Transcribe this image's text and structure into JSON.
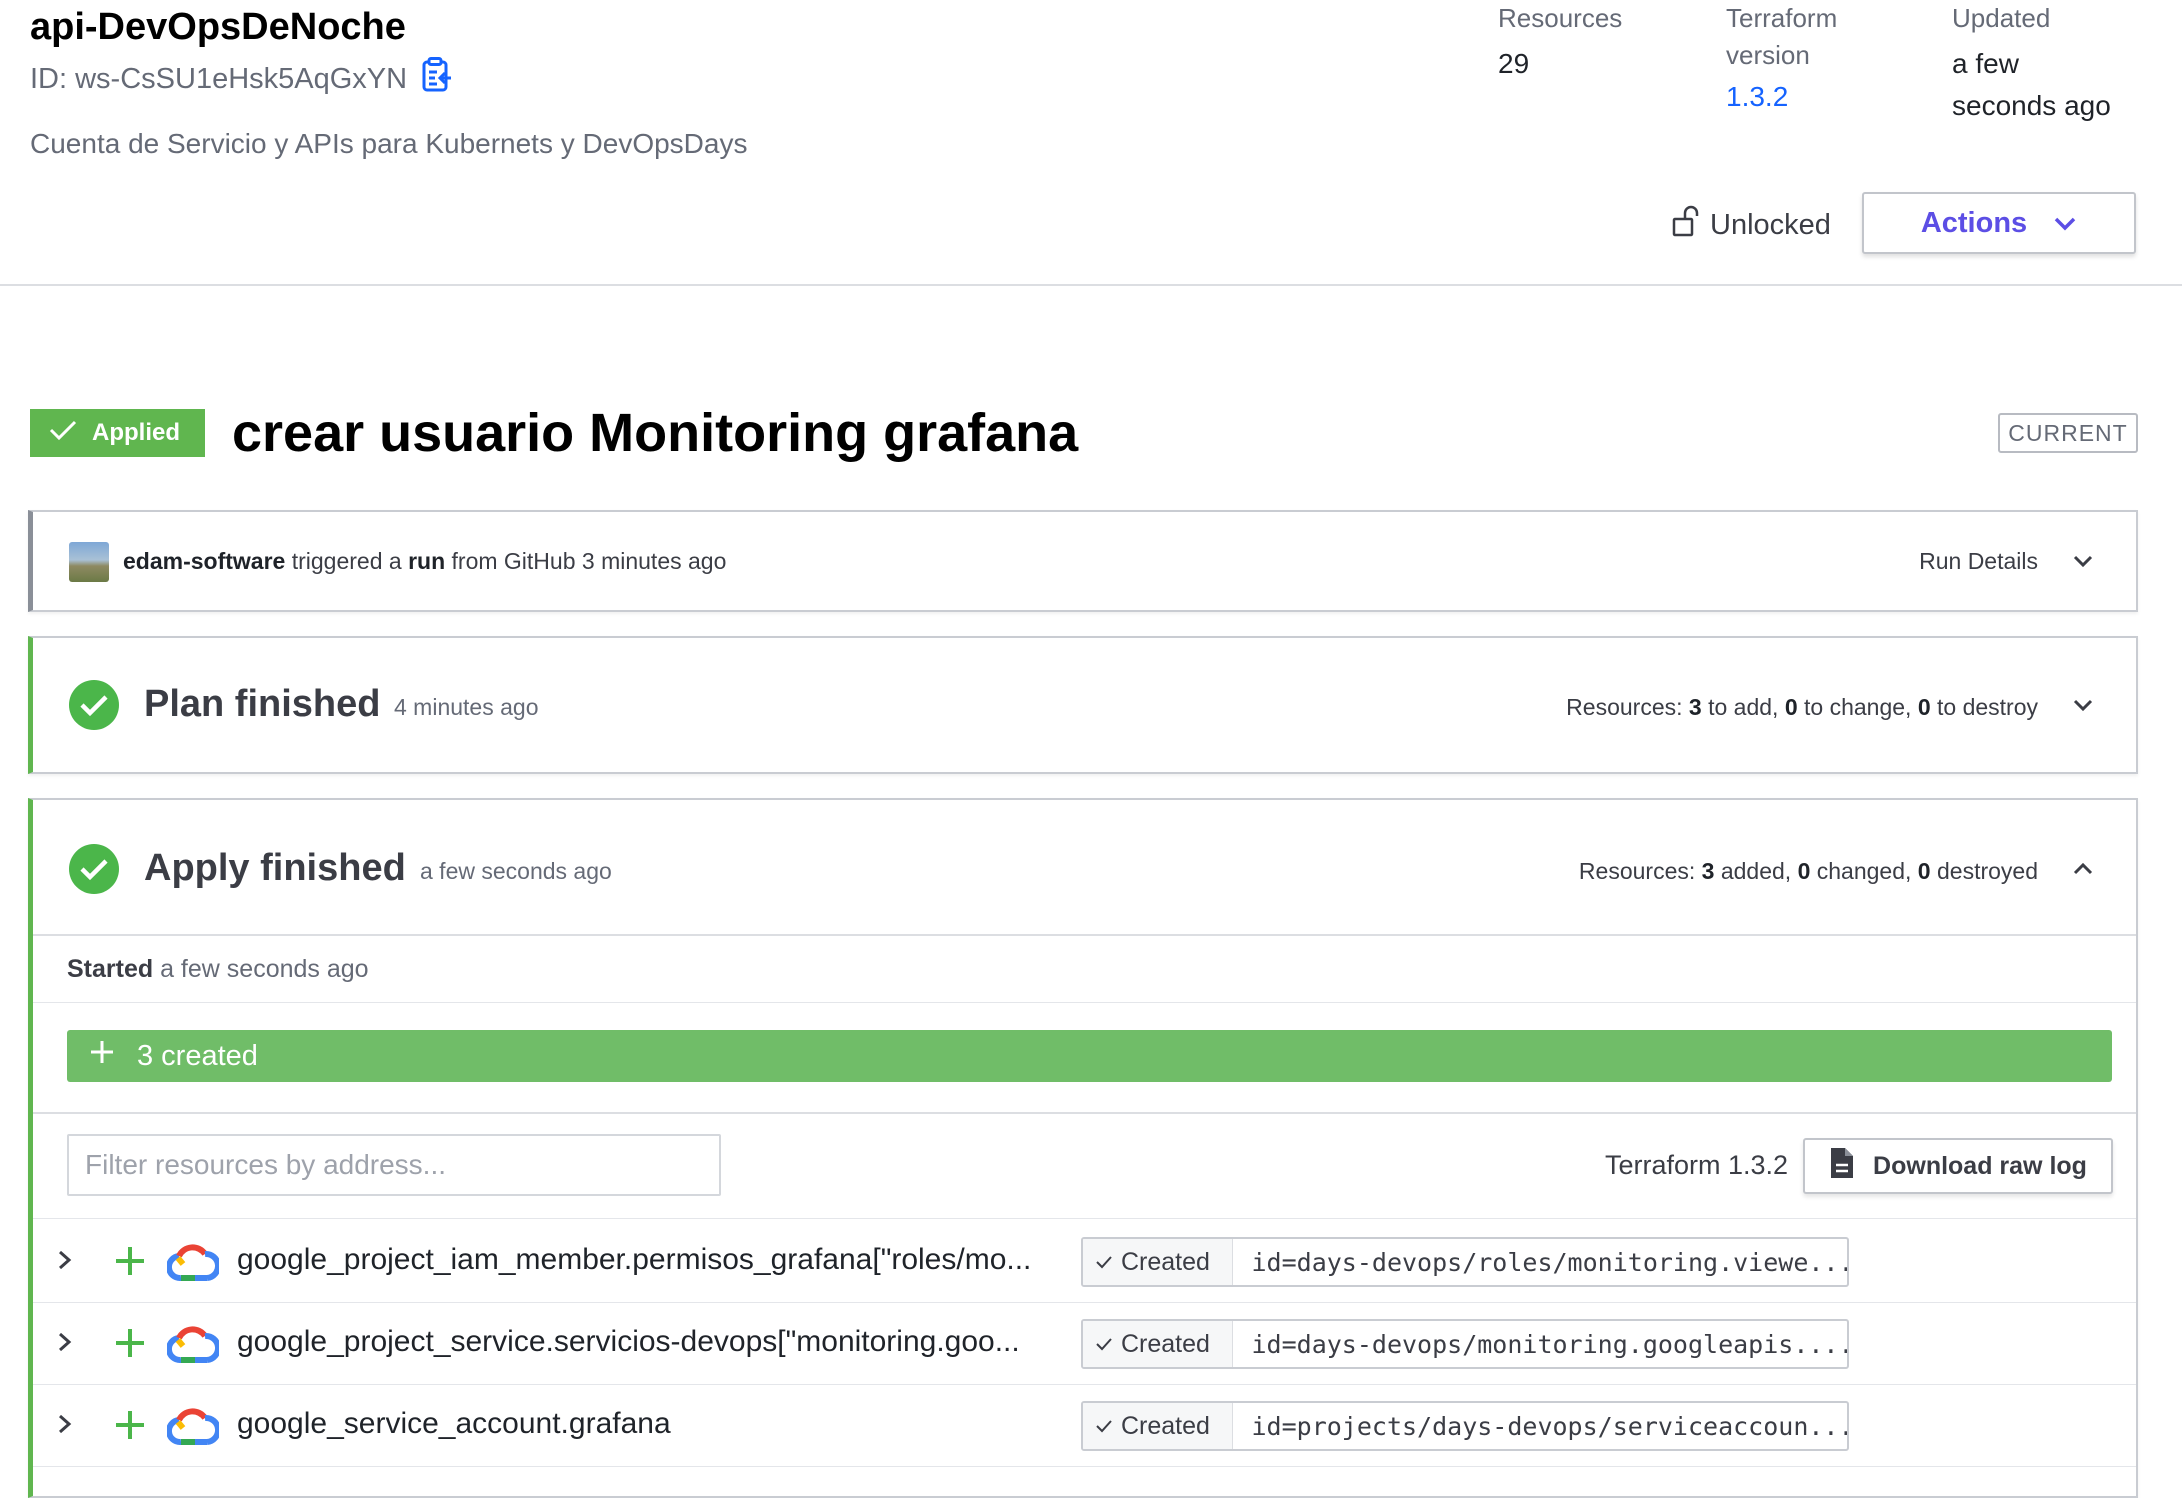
{
  "workspace": {
    "name": "api-DevOpsDeNoche",
    "id": "ID: ws-CsSU1eHsk5AqGxYN",
    "description": "Cuenta de Servicio y APIs para Kubernets y DevOpsDays",
    "meta": {
      "resources_label": "Resources",
      "resources_value": "29",
      "tf_version_label_1": "Terraform",
      "tf_version_label_2": "version",
      "tf_version_value": "1.3.2",
      "updated_label": "Updated",
      "updated_value_1": "a few",
      "updated_value_2": "seconds ago"
    },
    "lock_status": "Unlocked",
    "actions_label": "Actions"
  },
  "run": {
    "status_badge": "Applied",
    "title": "crear usuario Monitoring grafana",
    "current_badge": "CURRENT",
    "trigger": {
      "user": "edam-software",
      "text_1": " triggered a ",
      "run_word": "run",
      "text_2": " from GitHub 3 minutes ago",
      "details_label": "Run Details"
    },
    "plan": {
      "title": "Plan finished",
      "time": "4 minutes ago",
      "res_prefix": "Resources: ",
      "add": "3",
      "add_label": " to add, ",
      "change": "0",
      "change_label": " to change, ",
      "destroy": "0",
      "destroy_label": " to destroy"
    },
    "apply": {
      "title": "Apply finished",
      "time": "a few seconds ago",
      "res_prefix": "Resources: ",
      "added": "3",
      "added_label": " added, ",
      "changed": "0",
      "changed_label": " changed, ",
      "destroyed": "0",
      "destroyed_label": " destroyed",
      "started_label": "Started",
      "started_time": " a few seconds ago",
      "created_summary": "3 created",
      "filter_placeholder": "Filter resources by address...",
      "terraform_version": "Terraform 1.3.2",
      "download_label": "Download raw log",
      "resources": [
        {
          "address": "google_project_iam_member.permisos_grafana[\"roles/mo...",
          "status": "Created",
          "id": "id=days-devops/roles/monitoring.viewe..."
        },
        {
          "address": "google_project_service.servicios-devops[\"monitoring.goo...",
          "status": "Created",
          "id": "id=days-devops/monitoring.googleapis...."
        },
        {
          "address": "google_service_account.grafana",
          "status": "Created",
          "id": "id=projects/days-devops/serviceaccoun..."
        }
      ]
    }
  },
  "colors": {
    "success_green": "#60b64f",
    "created_bar_green": "#70bd68",
    "actions_purple": "#5c4ee5",
    "link_blue": "#1563ff"
  },
  "icons": [
    "clipboard-icon",
    "unlock-icon",
    "chevron-down-icon",
    "chevron-up-icon",
    "check-icon",
    "check-circle-icon",
    "plus-icon",
    "file-icon",
    "chevron-right-icon",
    "google-cloud-icon"
  ]
}
